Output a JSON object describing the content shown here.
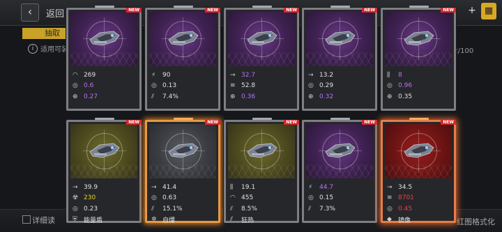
{
  "header": {
    "back_icon": "chevron-left-icon",
    "back_label": "返回",
    "add_icon": "plus-icon",
    "cart_icon": "cart-icon"
  },
  "background": {
    "tab_label": "抽取",
    "info_text": "适用可装",
    "count": "42/100",
    "bottom_left": "详细读",
    "bottom_right": "红图格式化"
  },
  "badge_text": "NEW",
  "cards": [
    {
      "theme": "purple",
      "stats": [
        {
          "icon": "dome-icon",
          "glyph": "◠",
          "value": "269",
          "color": "white"
        },
        {
          "icon": "target-icon",
          "glyph": "◎",
          "value": "0.6",
          "color": "purple"
        },
        {
          "icon": "crosshair-icon",
          "glyph": "⊕",
          "value": "0.27",
          "color": "purple"
        }
      ]
    },
    {
      "theme": "purple",
      "stats": [
        {
          "icon": "lightning-icon",
          "glyph": "⚡",
          "value": "90",
          "color": "white"
        },
        {
          "icon": "target-icon",
          "glyph": "◎",
          "value": "0.13",
          "color": "white"
        },
        {
          "icon": "critical-icon",
          "glyph": "⫽",
          "value": "7.4%",
          "color": "white"
        }
      ]
    },
    {
      "theme": "purple",
      "stats": [
        {
          "icon": "speed-icon",
          "glyph": "→",
          "value": "32.7",
          "color": "purple"
        },
        {
          "icon": "wave-icon",
          "glyph": "≋",
          "value": "52.8",
          "color": "white"
        },
        {
          "icon": "crosshair-icon",
          "glyph": "⊕",
          "value": "0.36",
          "color": "purple"
        }
      ]
    },
    {
      "theme": "purple",
      "stats": [
        {
          "icon": "speed-icon",
          "glyph": "→",
          "value": "13.2",
          "color": "white"
        },
        {
          "icon": "target-icon",
          "glyph": "◎",
          "value": "0.29",
          "color": "white"
        },
        {
          "icon": "crosshair-icon",
          "glyph": "⊕",
          "value": "0.32",
          "color": "purple"
        }
      ]
    },
    {
      "theme": "purple",
      "stats": [
        {
          "icon": "bars-icon",
          "glyph": "⫼",
          "value": "8",
          "color": "purple"
        },
        {
          "icon": "target-icon",
          "glyph": "◎",
          "value": "0.96",
          "color": "purple"
        },
        {
          "icon": "crosshair-icon",
          "glyph": "⊕",
          "value": "0.35",
          "color": "white"
        }
      ]
    },
    {
      "theme": "yellow",
      "stats": [
        {
          "icon": "speed-icon",
          "glyph": "→",
          "value": "39.9",
          "color": "white"
        },
        {
          "icon": "radiation-icon",
          "glyph": "☢",
          "value": "230",
          "color": "yellow"
        },
        {
          "icon": "target-icon",
          "glyph": "◎",
          "value": "0.23",
          "color": "white"
        },
        {
          "icon": "shield-icon",
          "glyph": "⛨",
          "value": "能量盾",
          "color": "white"
        }
      ]
    },
    {
      "theme": "orange",
      "stats": [
        {
          "icon": "speed-icon",
          "glyph": "→",
          "value": "41.4",
          "color": "white"
        },
        {
          "icon": "target-icon",
          "glyph": "◎",
          "value": "0.63",
          "color": "white"
        },
        {
          "icon": "critical-icon",
          "glyph": "⫽",
          "value": "15.1%",
          "color": "white"
        },
        {
          "icon": "gear-icon",
          "glyph": "✲",
          "value": "自爆",
          "color": "white"
        }
      ]
    },
    {
      "theme": "yellow",
      "stats": [
        {
          "icon": "bars-icon",
          "glyph": "⫼",
          "value": "19.1",
          "color": "white"
        },
        {
          "icon": "dome-icon",
          "glyph": "◠",
          "value": "455",
          "color": "white"
        },
        {
          "icon": "critical-icon",
          "glyph": "⫽",
          "value": "8.5%",
          "color": "white"
        },
        {
          "icon": "claw-icon",
          "glyph": "⫽",
          "value": "狂热",
          "color": "white"
        }
      ]
    },
    {
      "theme": "purple",
      "stats": [
        {
          "icon": "lightning-icon",
          "glyph": "⚡",
          "value": "44.7",
          "color": "purple"
        },
        {
          "icon": "target-icon",
          "glyph": "◎",
          "value": "0.15",
          "color": "white"
        },
        {
          "icon": "critical-icon",
          "glyph": "⫽",
          "value": "7.3%",
          "color": "white"
        }
      ]
    },
    {
      "theme": "red",
      "stats": [
        {
          "icon": "speed-icon",
          "glyph": "→",
          "value": "34.5",
          "color": "white"
        },
        {
          "icon": "wave-icon",
          "glyph": "≋",
          "value": "8701",
          "color": "red"
        },
        {
          "icon": "target-icon",
          "glyph": "◎",
          "value": "0.45",
          "color": "red"
        },
        {
          "icon": "mirror-icon",
          "glyph": "◆",
          "value": "镜像",
          "color": "white"
        }
      ]
    }
  ]
}
